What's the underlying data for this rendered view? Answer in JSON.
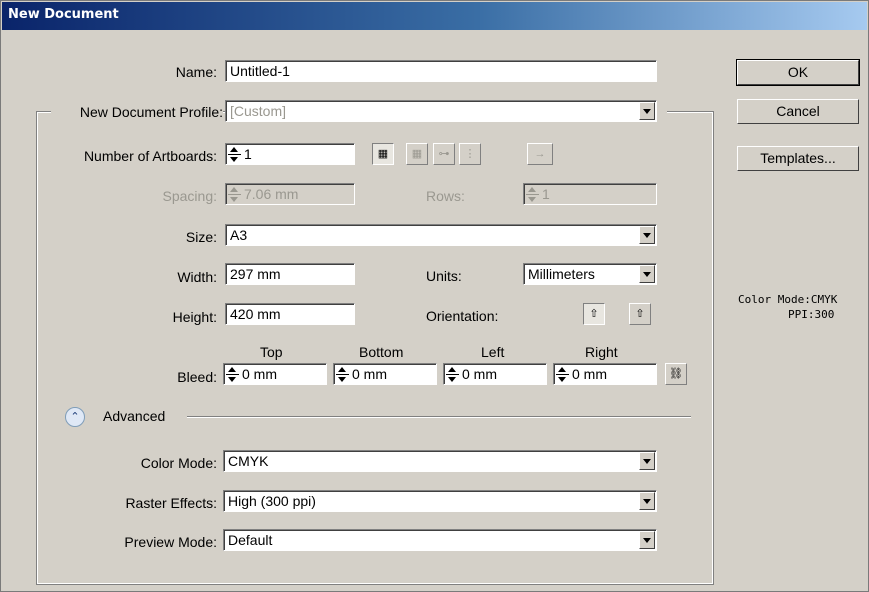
{
  "window": {
    "title": "New Document"
  },
  "buttons": {
    "ok": "OK",
    "cancel": "Cancel",
    "templates": "Templates..."
  },
  "info": {
    "color_mode": "Color Mode:CMYK",
    "ppi": "PPI:300"
  },
  "form": {
    "name_label": "Name:",
    "name_value": "Untitled-1",
    "profile_label": "New Document Profile:",
    "profile_value": "[Custom]",
    "artboards_label": "Number of Artboards:",
    "artboards_value": "1",
    "spacing_label": "Spacing:",
    "spacing_value": "7.06 mm",
    "rows_label": "Rows:",
    "rows_value": "1",
    "size_label": "Size:",
    "size_value": "A3",
    "width_label": "Width:",
    "width_value": "297 mm",
    "units_label": "Units:",
    "units_value": "Millimeters",
    "height_label": "Height:",
    "height_value": "420 mm",
    "orientation_label": "Orientation:",
    "bleed_label": "Bleed:",
    "bleed_headers": [
      "Top",
      "Bottom",
      "Left",
      "Right"
    ],
    "bleed_values": [
      "0 mm",
      "0 mm",
      "0 mm",
      "0 mm"
    ],
    "advanced_label": "Advanced",
    "color_mode_label": "Color Mode:",
    "color_mode_value": "CMYK",
    "raster_label": "Raster Effects:",
    "raster_value": "High (300 ppi)",
    "preview_label": "Preview Mode:",
    "preview_value": "Default"
  },
  "icons": {
    "grid_by_row": "grid-by-row-icon",
    "grid_by_column": "grid-by-column-icon",
    "arrange_by_row": "arrange-by-row-icon",
    "arrange_by_column": "arrange-by-column-icon",
    "right_to_left": "arrow-right-icon",
    "portrait": "portrait-icon",
    "landscape": "landscape-icon",
    "link": "link-icon",
    "collapse": "double-chevron-up-icon"
  }
}
